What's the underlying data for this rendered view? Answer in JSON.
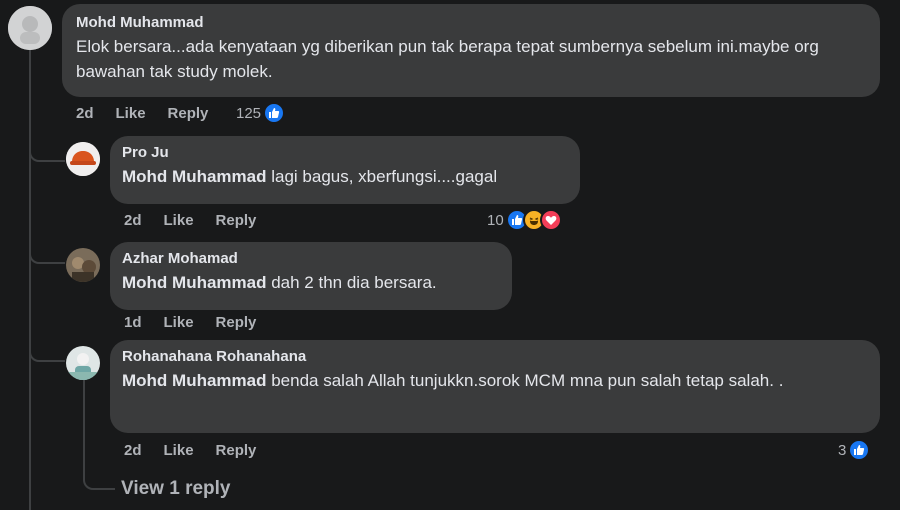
{
  "comments": [
    {
      "author": "Mohd Muhammad",
      "text": "Elok bersara...ada kenyataan yg diberikan pun tak berapa tepat sumbernya sebelum ini.maybe org bawahan tak study molek.",
      "time": "2d",
      "like_label": "Like",
      "reply_label": "Reply",
      "reaction_count": "125"
    }
  ],
  "replies": [
    {
      "author": "Pro Ju",
      "mention": "Mohd Muhammad",
      "text": " lagi bagus, xberfungsi....gagal",
      "time": "2d",
      "like_label": "Like",
      "reply_label": "Reply",
      "reaction_count": "10"
    },
    {
      "author": "Azhar Mohamad",
      "mention": "Mohd Muhammad",
      "text": " dah 2 thn dia bersara.",
      "time": "1d",
      "like_label": "Like",
      "reply_label": "Reply"
    },
    {
      "author": "Rohanahana Rohanahana",
      "mention": "Mohd Muhammad",
      "text": " benda salah Allah tunjukkn.sorok MCM mna pun salah tetap salah. .",
      "time": "2d",
      "like_label": "Like",
      "reply_label": "Reply",
      "reaction_count": "3"
    }
  ],
  "view_more": "View 1 reply",
  "colors": {
    "like": "#1877f2",
    "love": "#f33e58",
    "haha": "#f7b125",
    "bubble": "#3a3b3c",
    "background": "#18191a"
  }
}
